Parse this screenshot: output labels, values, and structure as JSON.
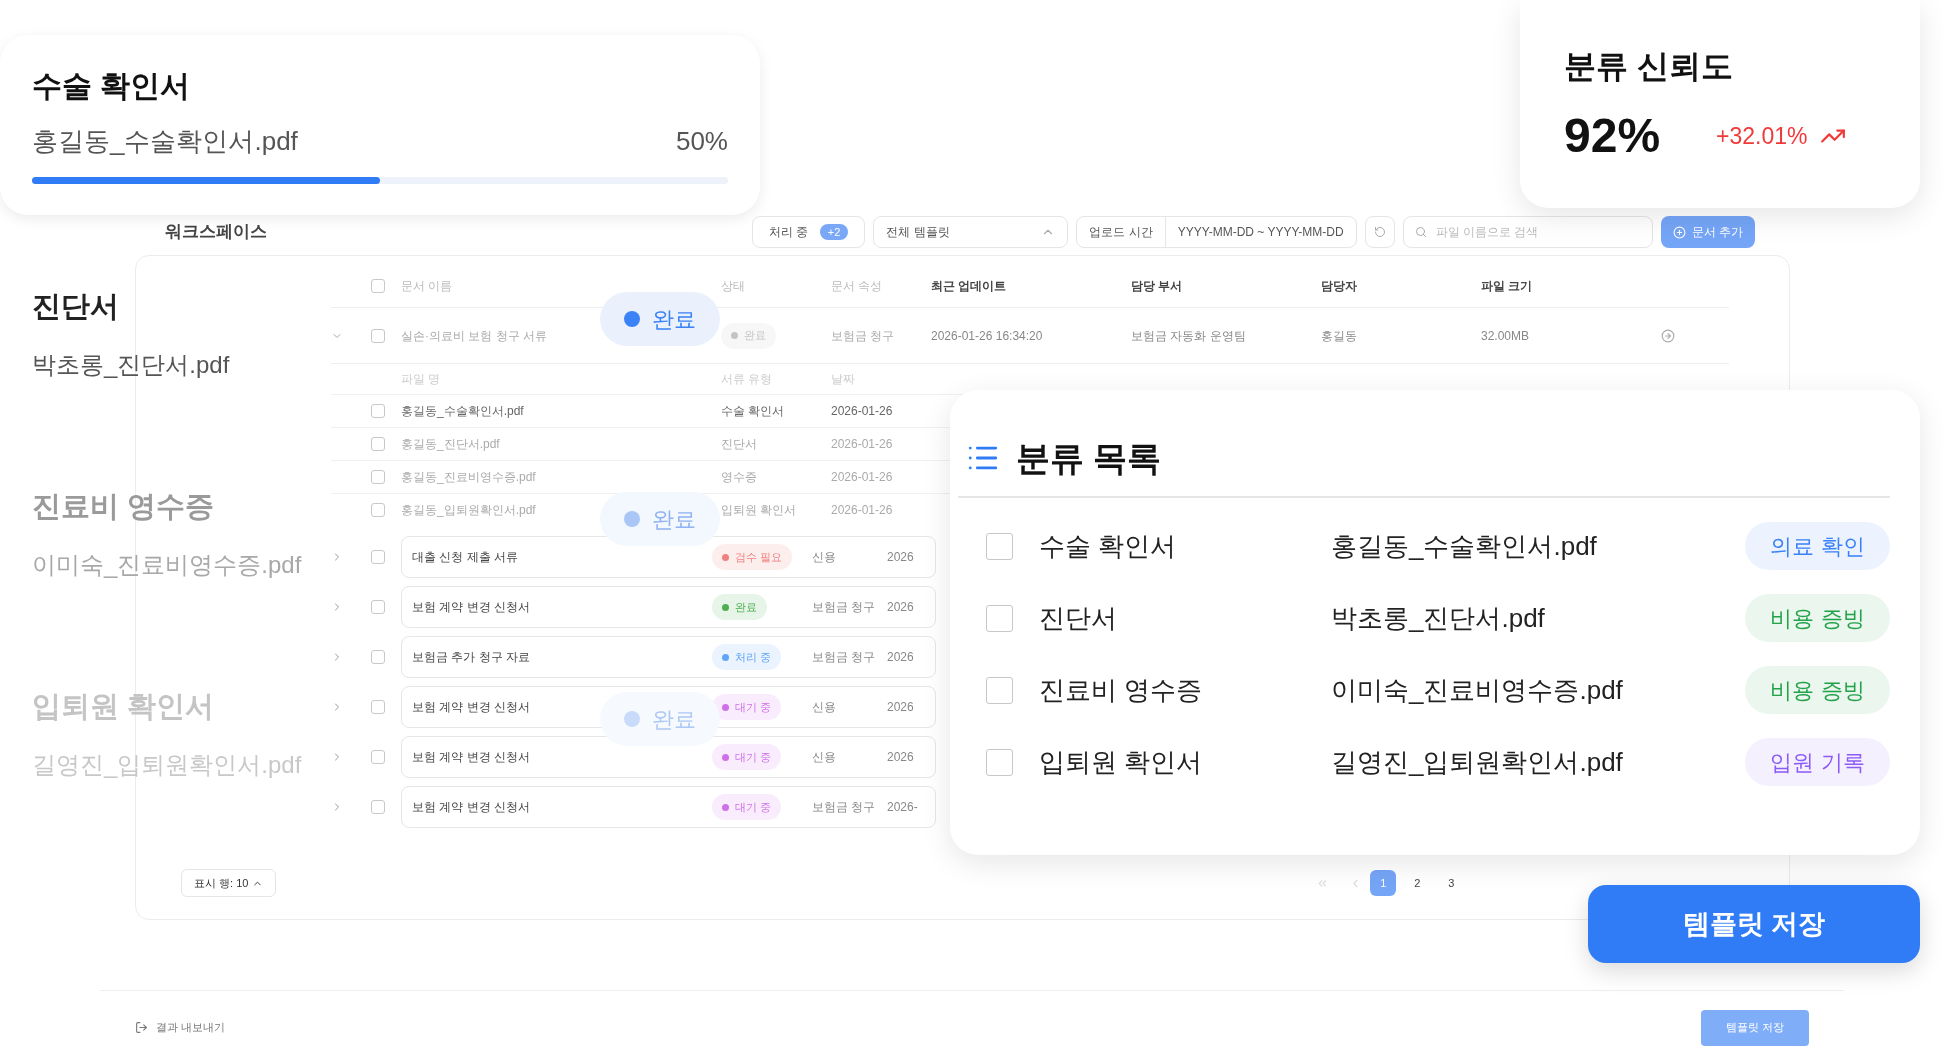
{
  "upload_card": {
    "title": "수술 확인서",
    "file": "홍길동_수술확인서.pdf",
    "percent": "50%",
    "level": 0.5
  },
  "confidence_card": {
    "title": "분류 신뢰도",
    "value": "92%",
    "change": "+32.01%"
  },
  "document_stack": [
    {
      "type": "진단서",
      "file": "박초롱_진단서.pdf",
      "kind": "current"
    },
    {
      "type": "진료비 영수증",
      "file": "이미숙_진료비영수증.pdf",
      "kind": "fading"
    },
    {
      "type": "입퇴원 확인서",
      "file": "길영진_입퇴원확인서.pdf",
      "kind": "faded"
    }
  ],
  "status_pills": [
    {
      "label": "완료",
      "kind": "current"
    },
    {
      "label": "완료",
      "kind": "fading"
    },
    {
      "label": "완료",
      "kind": "faded"
    }
  ],
  "workspace": {
    "title": "워크스페이스",
    "toolbar": {
      "processing": "처리 중",
      "processing_count": "+2",
      "template_filter": "전체 템플릿",
      "upload_label": "업로드 시간",
      "date_range": "YYYY-MM-DD ~ YYYY-MM-DD",
      "search_placeholder": "파일 이름으로 검색",
      "add_button": "문서 추가"
    },
    "table": {
      "select_all_checked": false,
      "columns": [
        "문서 이름",
        "상태",
        "문서 속성",
        "최근 업데이트",
        "담당 부서",
        "담당자",
        "파일 크기"
      ],
      "group": {
        "name": "실손·의료비 보험 청구 서류",
        "status": "완료",
        "color": "#c4c4c4",
        "attribute": "보험금 청구",
        "updated": "2026-01-26 16:34:20",
        "department": "보험금 자동화 운영팀",
        "owner": "홍길동",
        "size": "32.00MB",
        "expanded": true,
        "checked": false,
        "sub_columns": [
          "파일 명",
          "서류 유형",
          "날짜"
        ],
        "files": [
          {
            "name": "홍길동_수술확인서.pdf",
            "type": "수술 확인서",
            "date": "2026-01-26",
            "checked": false
          },
          {
            "name": "홍길동_진단서.pdf",
            "type": "진단서",
            "date": "2026-01-26",
            "checked": false
          },
          {
            "name": "홍길동_진료비영수증.pdf",
            "type": "영수증",
            "date": "2026-01-26",
            "checked": false
          },
          {
            "name": "홍길동_입퇴원확인서.pdf",
            "type": "입퇴원 확인서",
            "date": "2026-01-26",
            "checked": false
          }
        ]
      },
      "rows": [
        {
          "name": "대출 신청 제출 서류",
          "status": "검수 필요",
          "color": "#f08080",
          "attribute": "신용",
          "updated": "2026",
          "expanded": false,
          "checked": false
        },
        {
          "name": "보험 계약 변경 신청서",
          "status": "완료",
          "color": "#4caf50",
          "attribute": "보험금 청구",
          "updated": "2026",
          "expanded": false,
          "checked": false
        },
        {
          "name": "보험금 추가 청구 자료",
          "status": "처리 중",
          "color": "#60a5fa",
          "attribute": "보험금 청구",
          "updated": "2026",
          "expanded": false,
          "checked": false
        },
        {
          "name": "보험 계약 변경 신청서",
          "status": "대기 중",
          "color": "#d070e8",
          "attribute": "신용",
          "updated": "2026",
          "expanded": false,
          "checked": false
        },
        {
          "name": "보험 계약 변경 신청서",
          "status": "대기 중",
          "color": "#d070e8",
          "attribute": "신용",
          "updated": "2026",
          "expanded": false,
          "checked": false
        },
        {
          "name": "보험 계약 변경 신청서",
          "status": "대기 중",
          "color": "#d070e8",
          "attribute": "보험금 청구",
          "updated": "2026-",
          "expanded": false,
          "checked": false
        }
      ],
      "rows_per_page": "표시 행: 10",
      "pages": [
        {
          "label": "1",
          "selected": true
        },
        {
          "label": "2",
          "selected": false
        },
        {
          "label": "3",
          "selected": false
        }
      ]
    },
    "footer": {
      "export": "결과 내보내기",
      "save_button": "템플릿 저장"
    }
  },
  "classification_card": {
    "title": "분류 목록",
    "items": [
      {
        "type": "수술 확인서",
        "file": "홍길동_수술확인서.pdf",
        "tag": "의료 확인",
        "color": "#3b82f6",
        "checked": false
      },
      {
        "type": "진단서",
        "file": "박초롱_진단서.pdf",
        "tag": "비용 증빙",
        "color": "#22a34a",
        "checked": false
      },
      {
        "type": "진료비 영수증",
        "file": "이미숙_진료비영수증.pdf",
        "tag": "비용 증빙",
        "color": "#22a34a",
        "checked": false
      },
      {
        "type": "입퇴원 확인서",
        "file": "길영진_입퇴원확인서.pdf",
        "tag": "입원 기록",
        "color": "#8b5cf6",
        "checked": false
      }
    ]
  },
  "save_template_button": "템플릿 저장"
}
